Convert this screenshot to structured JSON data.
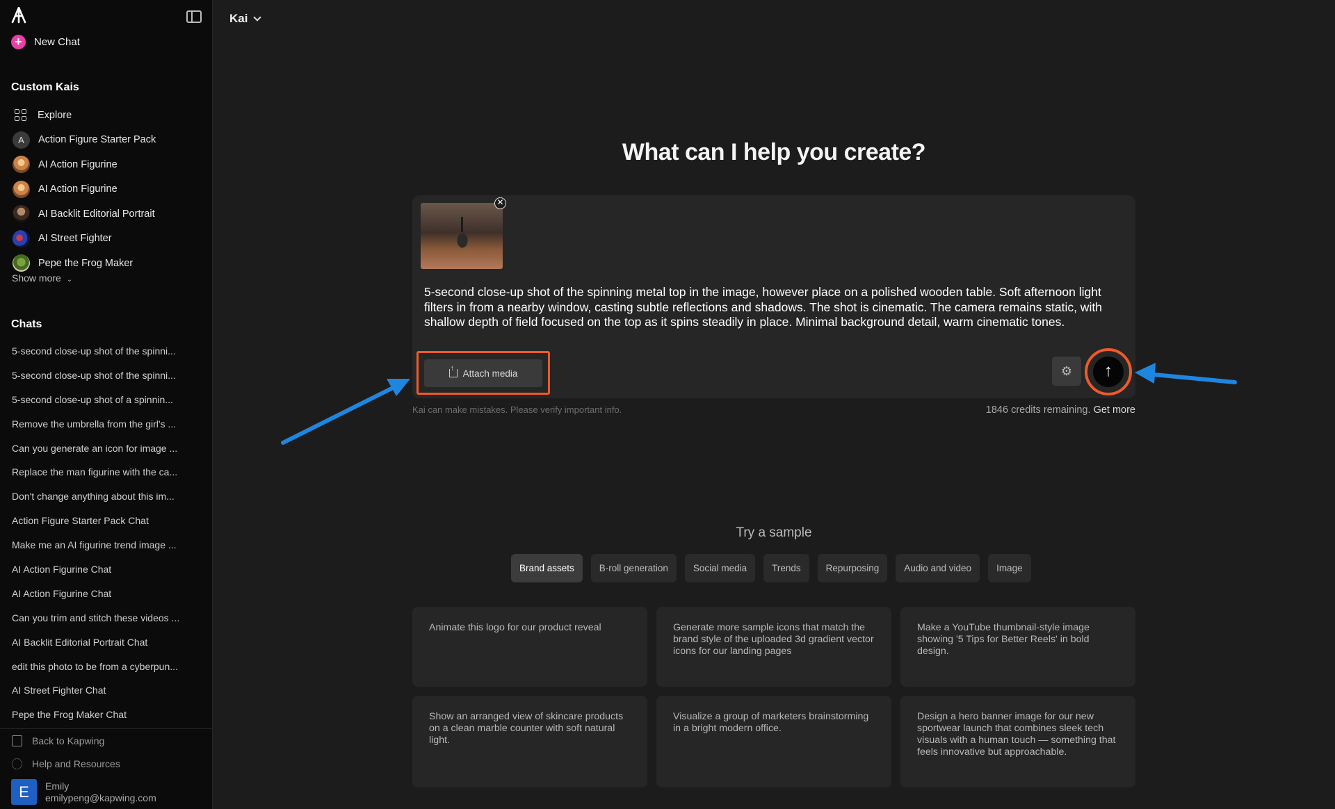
{
  "sidebar": {
    "new_chat": "New Chat",
    "custom_kais_title": "Custom Kais",
    "kais": [
      {
        "label": "Explore"
      },
      {
        "label": "Action Figure Starter Pack",
        "initial": "A"
      },
      {
        "label": "AI Action Figurine"
      },
      {
        "label": "AI Action Figurine"
      },
      {
        "label": "AI Backlit Editorial Portrait"
      },
      {
        "label": "AI Street Fighter"
      },
      {
        "label": "Pepe the Frog Maker"
      }
    ],
    "show_more": "Show more",
    "chats_title": "Chats",
    "chats": [
      "5-second close-up shot of the spinni...",
      "5-second close-up shot of the spinni...",
      "5-second close-up shot of a spinnin...",
      "Remove the umbrella from the girl's ...",
      "Can you generate an icon for image ...",
      "Replace the man figurine with the ca...",
      "Don't change anything about this im...",
      "Action Figure Starter Pack Chat",
      "Make me an AI figurine trend image ...",
      "AI Action Figurine Chat",
      "AI Action Figurine Chat",
      "Can you trim and stitch these videos ...",
      "AI Backlit Editorial Portrait Chat",
      "edit this photo to be from a cyberpun...",
      "AI Street Fighter Chat",
      "Pepe the Frog Maker Chat"
    ],
    "footer": {
      "back": "Back to Kapwing",
      "help": "Help and Resources",
      "user_initial": "E",
      "user_name": "Emily",
      "user_email": "emilypeng@kapwing.com"
    }
  },
  "header": {
    "kai_select": "Kai"
  },
  "main": {
    "headline": "What can I help you create?",
    "prompt_text": "5-second close-up shot of the spinning metal top in the image, however place on a polished wooden table. Soft afternoon light filters in from a nearby window, casting subtle reflections and shadows. The shot is cinematic. The camera remains static, with shallow depth of field focused on the top as it spins steadily in place. Minimal background detail, warm cinematic tones.",
    "attach_label": "Attach media",
    "disclaimer": "Kai can make mistakes. Please verify important info.",
    "credits": "1846 credits remaining.",
    "get_more": "Get more",
    "sample_title": "Try a sample",
    "tabs": [
      "Brand assets",
      "B-roll generation",
      "Social media",
      "Trends",
      "Repurposing",
      "Audio and video",
      "Image"
    ],
    "cards": [
      "Animate this logo for our product reveal",
      "Generate more sample icons that match the brand style of the uploaded 3d gradient vector icons for our landing pages",
      "Make a YouTube thumbnail-style image showing '5 Tips for Better Reels' in bold design.",
      "Show an arranged view of skincare products on a clean marble counter with soft natural light.",
      "Visualize a group of marketers brainstorming in a bright modern office.",
      "Design a hero banner image for our new sportwear launch that combines sleek tech visuals with a human touch — something that feels innovative but approachable."
    ]
  },
  "colors": {
    "accent_pink": "#ea3fa6",
    "highlight_orange": "#ee5a2a",
    "arrow_blue": "#1f86e0"
  }
}
